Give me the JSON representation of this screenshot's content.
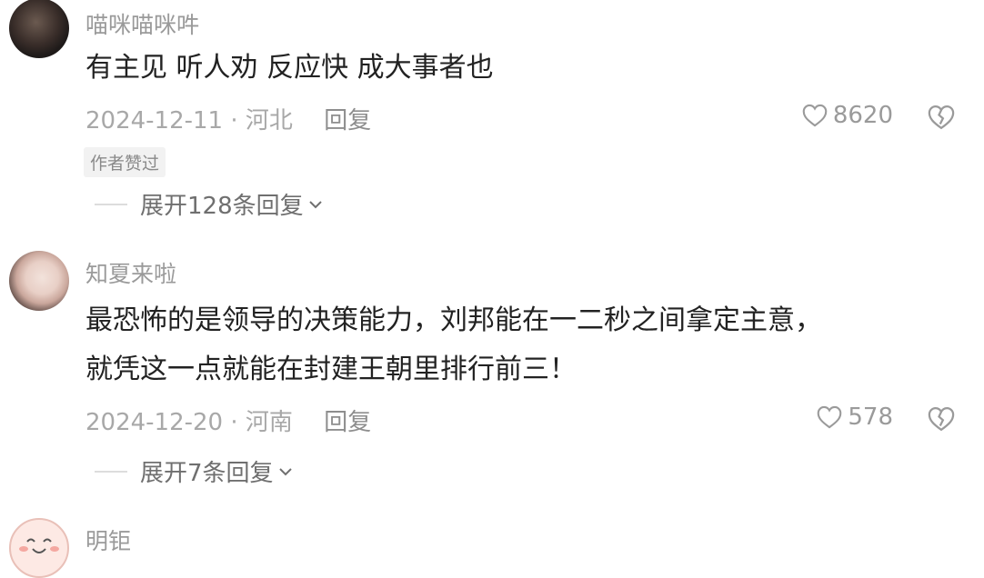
{
  "comments": [
    {
      "username": "喵咪喵咪吽",
      "text": "有主见 听人劝 反应快 成大事者也",
      "date": "2024-12-11",
      "separator": "·",
      "location": "河北",
      "reply_label": "回复",
      "likes": "8620",
      "badge": "作者赞过",
      "expand_label": "展开128条回复"
    },
    {
      "username": "知夏来啦",
      "text_line1": "最恐怖的是领导的决策能力，刘邦能在一二秒之间拿定主意，",
      "text_line2": "就凭这一点就能在封建王朝里排行前三！",
      "date": "2024-12-20",
      "separator": "·",
      "location": "河南",
      "reply_label": "回复",
      "likes": "578",
      "expand_label": "展开7条回复"
    },
    {
      "username": "明钜"
    }
  ],
  "icons": {
    "like": "heart-outline-icon",
    "dislike": "broken-heart-icon",
    "expand": "chevron-down-icon"
  }
}
